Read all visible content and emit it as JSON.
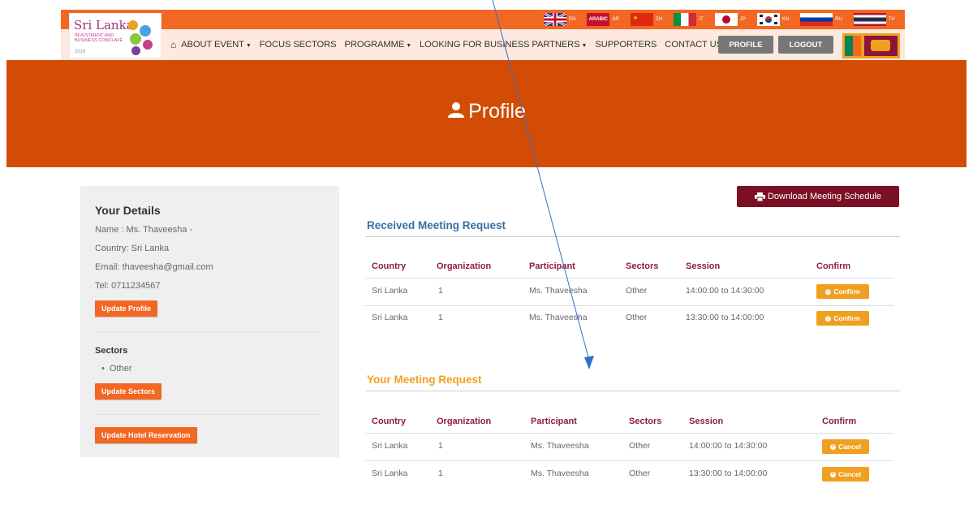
{
  "logo": {
    "line1": "Sri Lanka",
    "line2": "INVESTMENT AND BUSINESS CONCLAVE",
    "year": "2018"
  },
  "languages": [
    {
      "code": "EN",
      "flag": "uk-flag-icon"
    },
    {
      "code": "AR",
      "flag": "arabic-flag-icon",
      "label": "ARABIC"
    },
    {
      "code": "CH",
      "flag": "china-flag-icon"
    },
    {
      "code": "IT",
      "flag": "italy-flag-icon"
    },
    {
      "code": "JP",
      "flag": "japan-flag-icon"
    },
    {
      "code": "KN",
      "flag": "korea-flag-icon"
    },
    {
      "code": "RU",
      "flag": "russia-flag-icon"
    },
    {
      "code": "TH",
      "flag": "thailand-flag-icon"
    }
  ],
  "nav": {
    "about": "ABOUT EVENT",
    "focus": "FOCUS SECTORS",
    "programme": "PROGRAMME",
    "partners": "LOOKING FOR BUSINESS PARTNERS",
    "supporters": "SUPPORTERS",
    "contact": "CONTACT US",
    "profile": "PROFILE",
    "logout": "LOGOUT"
  },
  "banner": {
    "title": "Profile"
  },
  "details": {
    "heading": "Your Details",
    "name": "Name : Ms. Thaveesha -",
    "country": "Country: Sri Lanka",
    "email": "Email: thaveesha@gmail.com",
    "tel": "Tel: 0711234567",
    "update_profile": "Update Profile",
    "sectors_heading": "Sectors",
    "sector_item": "Other",
    "update_sectors": "Update Sectors",
    "update_hotel": "Update Hotel Reservation"
  },
  "download_label": "Download Meeting Schedule",
  "received": {
    "title": "Received Meeting Request",
    "headers": [
      "Country",
      "Organization",
      "Participant",
      "Sectors",
      "Session",
      "Confirm"
    ],
    "rows": [
      {
        "country": "Sri Lanka",
        "org": "1",
        "participant": "Ms. Thaveesha",
        "sector": "Other",
        "session": "14:00:00 to 14:30:00",
        "action": "Confirm"
      },
      {
        "country": "Sri Lanka",
        "org": "1",
        "participant": "Ms. Thaveesha",
        "sector": "Other",
        "session": "13:30:00 to 14:00:00",
        "action": "Confirm"
      }
    ]
  },
  "yours": {
    "title": "Your Meeting Request",
    "headers": [
      "Country",
      "Organization",
      "Participant",
      "Sectors",
      "Session",
      "Confirm"
    ],
    "rows": [
      {
        "country": "Sri Lanka",
        "org": "1",
        "participant": "Ms. Thaveesha",
        "sector": "Other",
        "session": "14:00:00 to 14:30:00",
        "action": "Cancel"
      },
      {
        "country": "Sri Lanka",
        "org": "1",
        "participant": "Ms. Thaveesha",
        "sector": "Other",
        "session": "13:30:00 to 14:00:00",
        "action": "Cancel"
      }
    ]
  },
  "colors": {
    "topbar": "#f26722",
    "banner": "#d34c05",
    "download": "#7b1024",
    "received_title": "#3a6ea5",
    "yours_title": "#f0a020",
    "table_header": "#8d1e3c",
    "action_button": "#f0a020"
  }
}
